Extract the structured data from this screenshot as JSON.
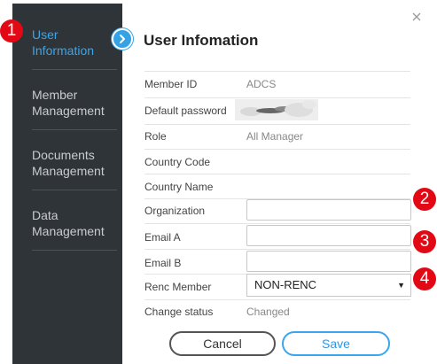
{
  "sidebar": {
    "items": [
      {
        "label": "User\nInformation",
        "active": true
      },
      {
        "label": "Member\nManagement",
        "active": false
      },
      {
        "label": "Documents\nManagement",
        "active": false
      },
      {
        "label": "Data\nManagement",
        "active": false
      }
    ]
  },
  "dialog": {
    "title": "User Infomation",
    "close_icon": "close-icon",
    "fields": {
      "member_id": {
        "label": "Member ID",
        "value": "ADCS"
      },
      "default_password": {
        "label": "Default password"
      },
      "role": {
        "label": "Role",
        "value": "All Manager"
      },
      "country_code": {
        "label": "Country Code",
        "value": ""
      },
      "country_name": {
        "label": "Country Name",
        "value": ""
      },
      "organization": {
        "label": "Organization",
        "value": ""
      },
      "email_a": {
        "label": "Email A",
        "value": ""
      },
      "email_b": {
        "label": "Email B",
        "value": ""
      },
      "renc_member": {
        "label": "Renc Member",
        "selected": "NON-RENC"
      },
      "change_status": {
        "label": "Change status",
        "value": "Changed"
      }
    },
    "buttons": {
      "cancel": "Cancel",
      "save": "Save"
    }
  },
  "markers": [
    "1",
    "2",
    "3",
    "4"
  ],
  "colors": {
    "sidebar_bg": "#2f3438",
    "accent": "#35a2e6",
    "marker": "#e30914"
  }
}
